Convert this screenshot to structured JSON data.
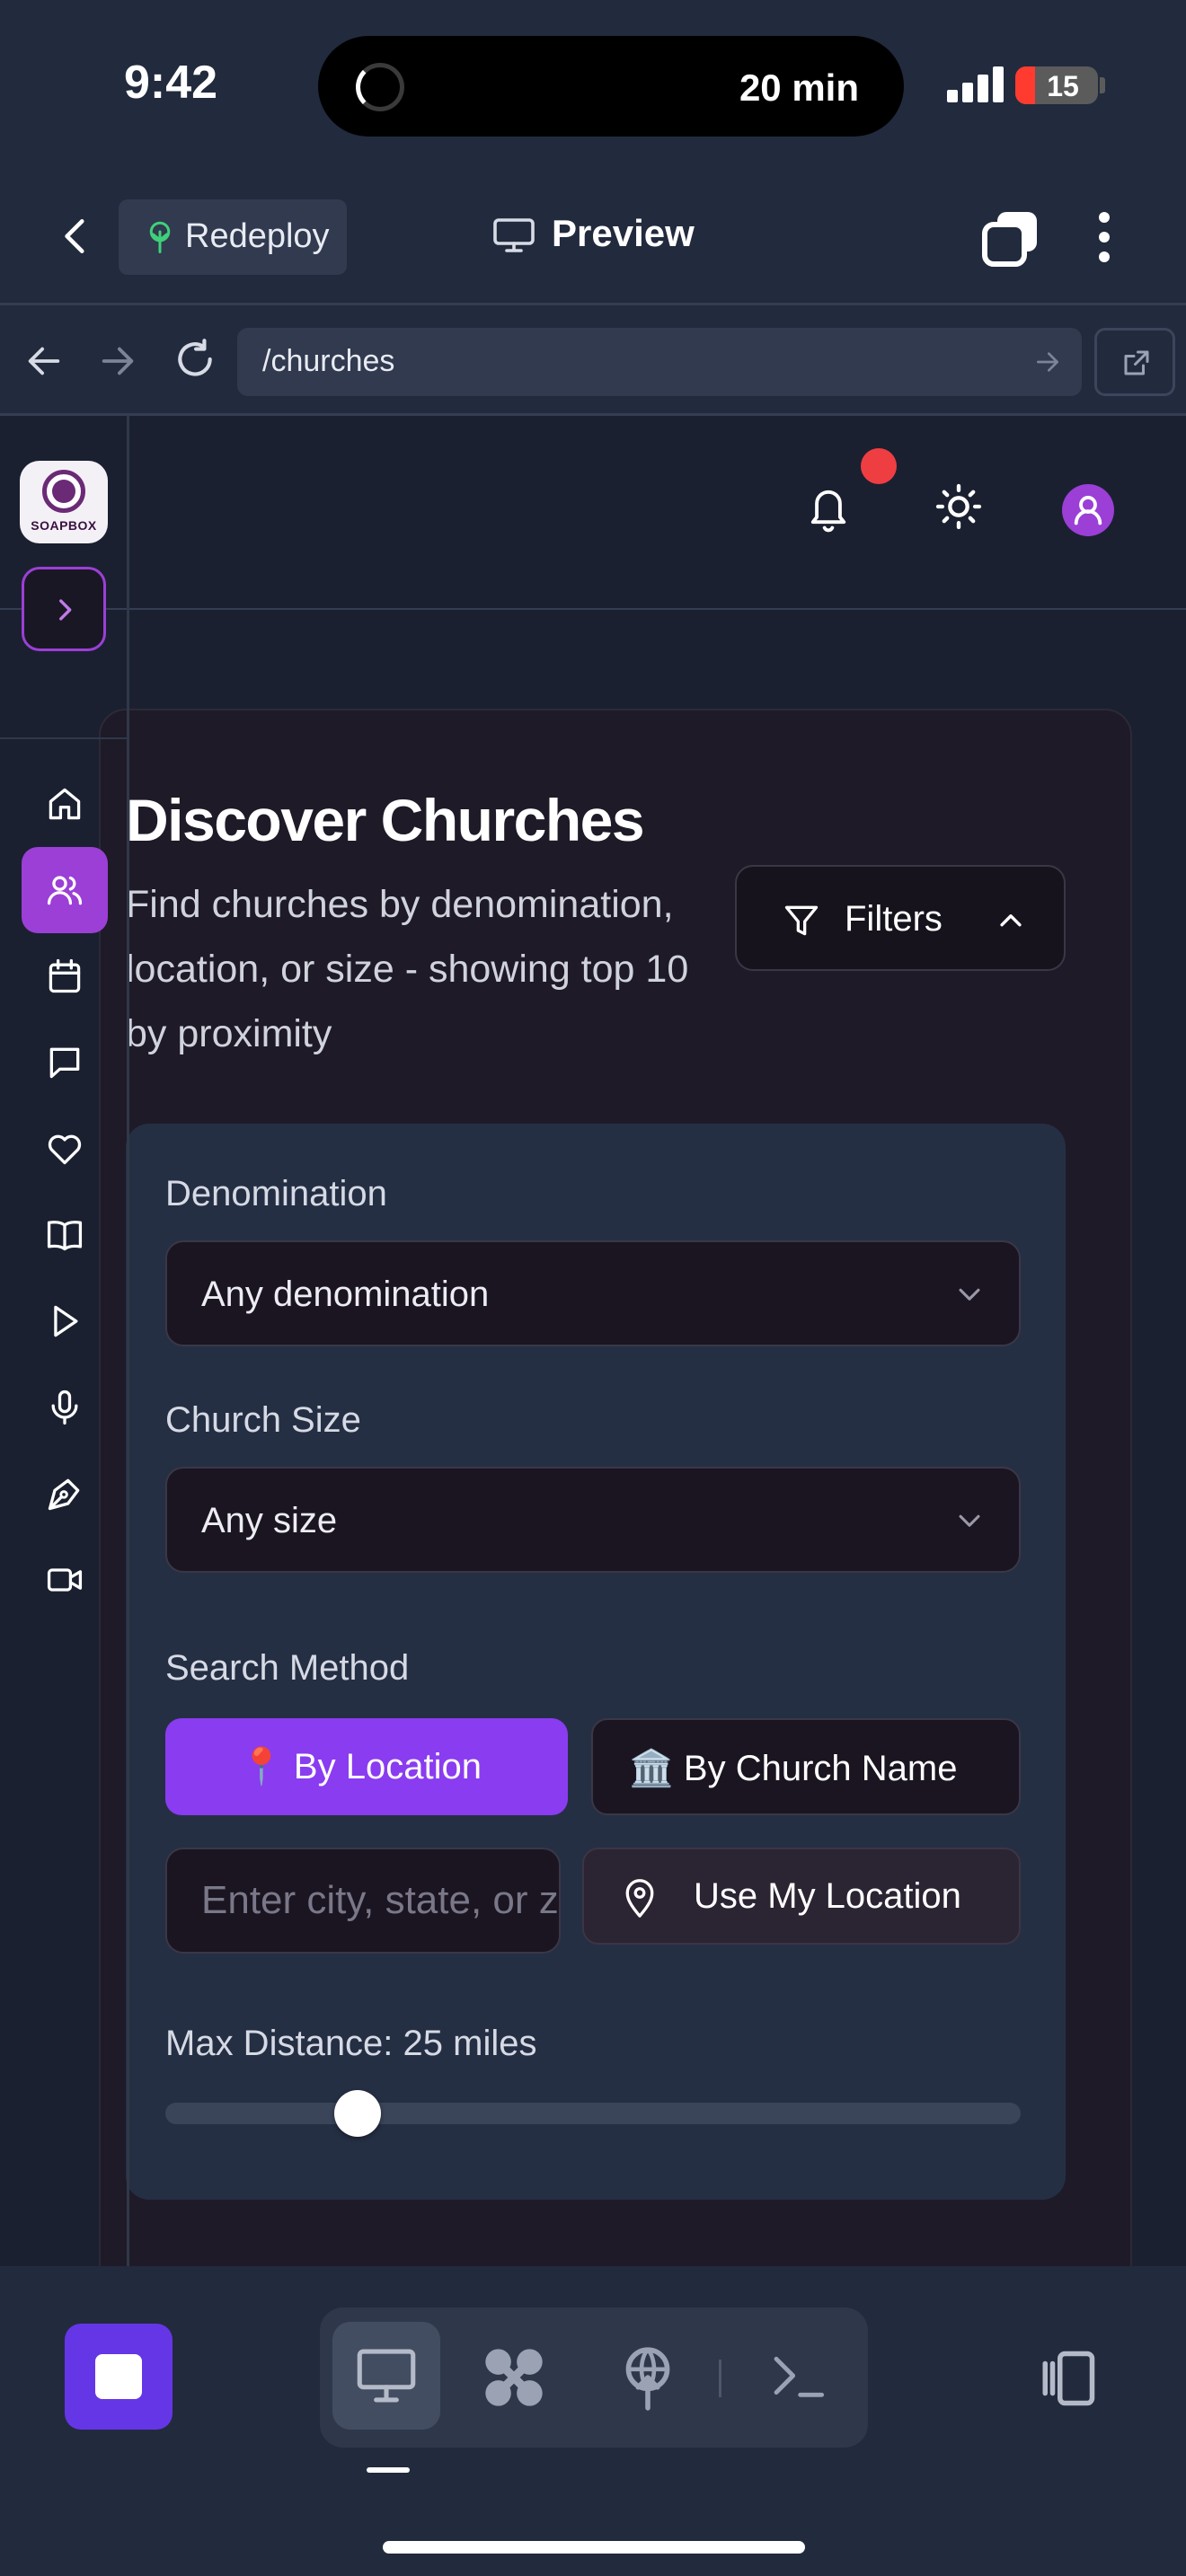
{
  "status_bar": {
    "time": "9:42",
    "activity": "20 min",
    "battery": "15"
  },
  "header": {
    "redeploy_label": "Redeploy",
    "preview_label": "Preview"
  },
  "url_bar": {
    "path": "/churches"
  },
  "app": {
    "logo_text": "SOAPBOX",
    "sidebar_icons": [
      "home-icon",
      "users-icon",
      "calendar-icon",
      "message-icon",
      "heart-icon",
      "book-icon",
      "play-icon",
      "microphone-icon",
      "pen-tool-icon",
      "video-icon"
    ],
    "active_nav": "users-icon",
    "page": {
      "title": "Discover Churches",
      "subtitle": "Find churches by denomination, location, or size - showing top 10 by proximity",
      "filters_label": "Filters"
    },
    "filters": {
      "denomination_label": "Denomination",
      "denomination_value": "Any denomination",
      "size_label": "Church Size",
      "size_value": "Any size",
      "search_method_label": "Search Method",
      "by_location": "📍 By Location",
      "by_church_name": "🏛️ By Church Name",
      "city_placeholder": "Enter city, state, or zip",
      "use_my_location": "Use My Location",
      "max_distance_label": "Max Distance: 25 miles",
      "max_distance_value": 25,
      "slider_fraction": 0.225
    },
    "colors": {
      "accent": "#9b3fd6",
      "primary_button": "#8a3cf0",
      "notification": "#ef3e42"
    }
  }
}
